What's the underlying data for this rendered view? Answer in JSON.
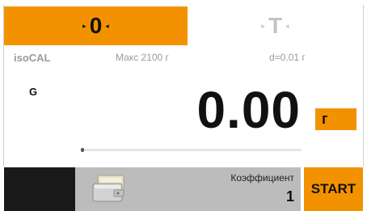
{
  "tabs": {
    "zero": {
      "symbol": "0",
      "left_arrow": "▸",
      "right_arrow": "◂"
    },
    "tare": {
      "symbol": "T",
      "left_arrow": "▸",
      "right_arrow": "◂"
    }
  },
  "info": {
    "mode": "isoCAL",
    "max": "Макс 2100 г",
    "readability": "d=0.01 г"
  },
  "weighing": {
    "gross_label": "G",
    "value": "0.00",
    "unit": "г"
  },
  "bottom": {
    "coefficient_label": "Коэффициент",
    "coefficient_value": "1",
    "start_label": "START"
  },
  "colors": {
    "accent": "#f39200",
    "panel_gray": "#bcbcbc",
    "dark_block": "#1a1a1a"
  },
  "icons": {
    "application_icon": "wallet-icon"
  }
}
